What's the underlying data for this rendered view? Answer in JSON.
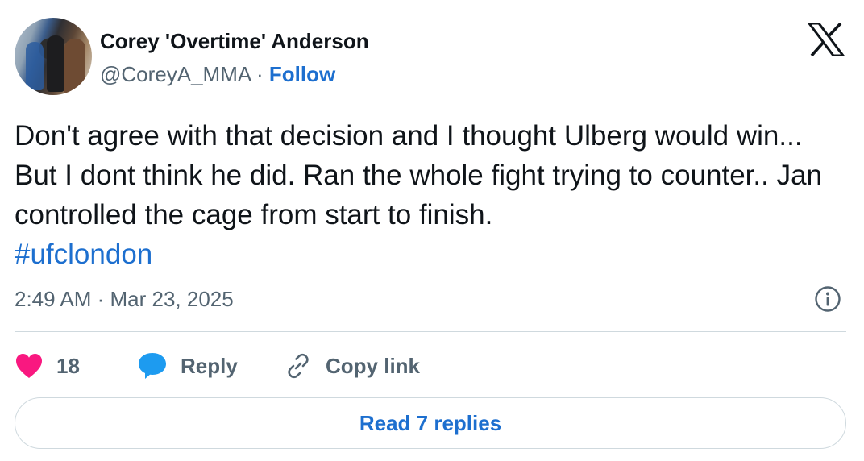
{
  "author": {
    "name": "Corey 'Overtime' Anderson",
    "handle": "@CoreyA_MMA",
    "separator": "·",
    "follow_label": "Follow"
  },
  "tweet": {
    "text": "Don't agree with that decision and I thought Ulberg would win... But I dont think he did. Ran the whole fight trying to counter.. Jan controlled the cage from start to finish.",
    "hashtag": "#ufclondon",
    "timestamp": "2:49 AM · Mar 23, 2025"
  },
  "actions": {
    "like_count": "18",
    "reply_label": "Reply",
    "copy_link_label": "Copy link"
  },
  "read_replies_label": "Read 7 replies",
  "colors": {
    "accent": "#1d6fcf",
    "like": "#f91880",
    "reply_bubble": "#1d9bf0",
    "muted": "#536471",
    "text": "#0f1419",
    "border": "#cfd9de"
  },
  "icons": [
    "x-logo-icon",
    "info-icon",
    "heart-icon",
    "reply-bubble-icon",
    "link-icon"
  ]
}
